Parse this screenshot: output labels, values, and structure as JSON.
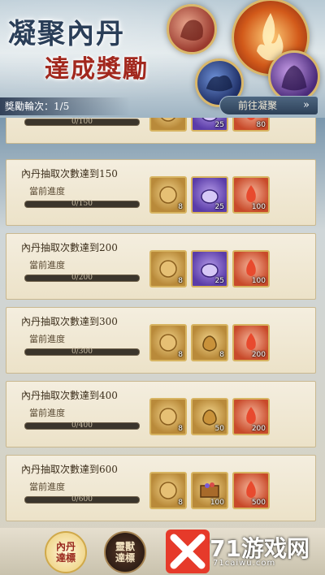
{
  "header": {
    "title": "凝聚內丹",
    "subtitle": "達成獎勵",
    "reward_round": "獎勵輪次：1/5",
    "goto_button": "前往凝聚",
    "goto_icon": "double-chevron-right"
  },
  "progress_label": "當前進度",
  "tasks": [
    {
      "title": "",
      "progress_text": "0/100",
      "progress": 0,
      "rewards": [
        {
          "type": "gold-pouch",
          "count": ""
        },
        {
          "type": "purple-pouch",
          "count": "25"
        },
        {
          "type": "red-flame",
          "count": "80"
        }
      ]
    },
    {
      "title": "內丹抽取次數達到150",
      "progress_text": "0/150",
      "progress": 0,
      "rewards": [
        {
          "type": "gold-pouch",
          "count": "8"
        },
        {
          "type": "purple-pouch",
          "count": "25"
        },
        {
          "type": "red-flame",
          "count": "100"
        }
      ]
    },
    {
      "title": "內丹抽取次數達到200",
      "progress_text": "0/200",
      "progress": 0,
      "rewards": [
        {
          "type": "gold-pouch",
          "count": "8"
        },
        {
          "type": "purple-pouch",
          "count": "25"
        },
        {
          "type": "red-flame",
          "count": "100"
        }
      ]
    },
    {
      "title": "內丹抽取次數達到300",
      "progress_text": "0/300",
      "progress": 0,
      "rewards": [
        {
          "type": "gold-pouch",
          "count": "8"
        },
        {
          "type": "gold-bag",
          "count": "8"
        },
        {
          "type": "red-flame",
          "count": "200"
        }
      ]
    },
    {
      "title": "內丹抽取次數達到400",
      "progress_text": "0/400",
      "progress": 0,
      "rewards": [
        {
          "type": "gold-pouch",
          "count": "8"
        },
        {
          "type": "gold-bag",
          "count": "50"
        },
        {
          "type": "red-flame",
          "count": "200"
        }
      ]
    },
    {
      "title": "內丹抽取次數達到600",
      "progress_text": "0/600",
      "progress": 0,
      "rewards": [
        {
          "type": "gold-pouch",
          "count": "8"
        },
        {
          "type": "gold-chest",
          "count": "100"
        },
        {
          "type": "red-flame",
          "count": "500"
        }
      ]
    }
  ],
  "tabs": [
    {
      "label": "內丹達標",
      "active": true
    },
    {
      "label": "靈獸達標",
      "active": false
    }
  ],
  "watermark": {
    "text": "71游戏网",
    "sub": "71caiwu.com"
  },
  "colors": {
    "accent_red": "#a2281e",
    "card_bg": "#f4eedf",
    "border_gold": "#d7b461"
  }
}
